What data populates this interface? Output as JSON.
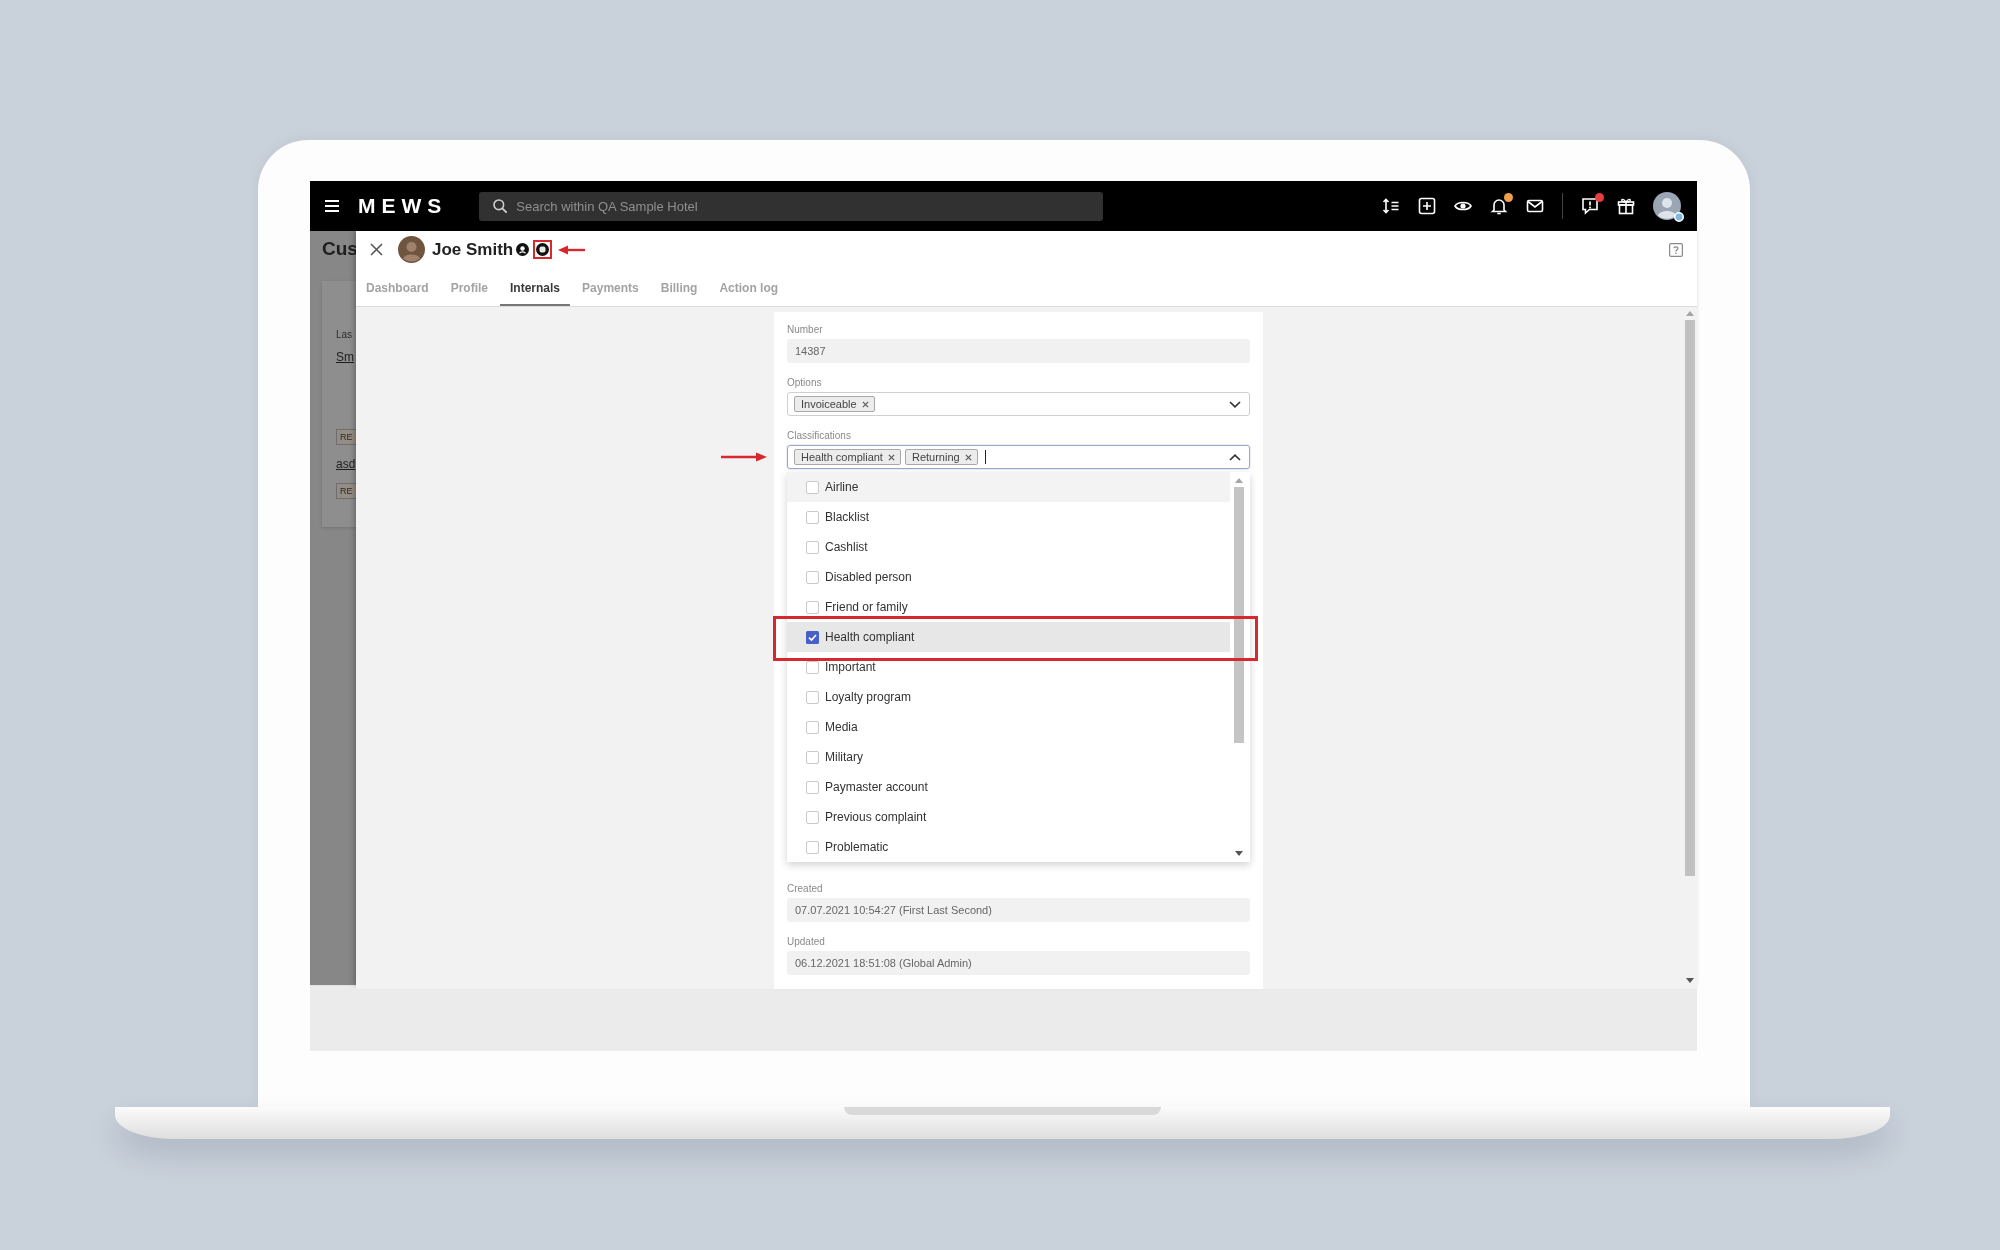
{
  "top_bar": {
    "logo": "MEWS",
    "search": {
      "placeholder": "Search within QA Sample Hotel"
    }
  },
  "background_page": {
    "title": "Cus",
    "field_label": "Las",
    "field_value": "Sm",
    "entries": [
      {
        "kind": "tag",
        "text": "RE"
      },
      {
        "kind": "link",
        "text": "asd"
      },
      {
        "kind": "tag",
        "text": "RE"
      }
    ]
  },
  "customer_panel": {
    "name": "Joe Smith",
    "tabs": [
      {
        "label": "Dashboard",
        "selected": false
      },
      {
        "label": "Profile",
        "selected": false
      },
      {
        "label": "Internals",
        "selected": true
      },
      {
        "label": "Payments",
        "selected": false
      },
      {
        "label": "Billing",
        "selected": false
      },
      {
        "label": "Action log",
        "selected": false
      }
    ]
  },
  "form": {
    "fields": [
      {
        "kind": "readonly",
        "label": "Number",
        "value": "14387"
      },
      {
        "kind": "multiselect",
        "label": "Options",
        "chips": [
          "Invoiceable"
        ],
        "expanded": false
      },
      {
        "kind": "multiselect",
        "label": "Classifications",
        "chips": [
          "Health compliant",
          "Returning"
        ],
        "expanded": true,
        "options": [
          {
            "label": "Airline",
            "checked": false,
            "focused": true,
            "hovered": false
          },
          {
            "label": "Blacklist",
            "checked": false,
            "focused": false,
            "hovered": false
          },
          {
            "label": "Cashlist",
            "checked": false,
            "focused": false,
            "hovered": false
          },
          {
            "label": "Disabled person",
            "checked": false,
            "focused": false,
            "hovered": false
          },
          {
            "label": "Friend or family",
            "checked": false,
            "focused": false,
            "hovered": false
          },
          {
            "label": "Health compliant",
            "checked": true,
            "focused": false,
            "hovered": true
          },
          {
            "label": "Important",
            "checked": false,
            "focused": false,
            "hovered": false
          },
          {
            "label": "Loyalty program",
            "checked": false,
            "focused": false,
            "hovered": false
          },
          {
            "label": "Media",
            "checked": false,
            "focused": false,
            "hovered": false
          },
          {
            "label": "Military",
            "checked": false,
            "focused": false,
            "hovered": false
          },
          {
            "label": "Paymaster account",
            "checked": false,
            "focused": false,
            "hovered": false
          },
          {
            "label": "Previous complaint",
            "checked": false,
            "focused": false,
            "hovered": false
          },
          {
            "label": "Problematic",
            "checked": false,
            "focused": false,
            "hovered": false
          }
        ]
      }
    ],
    "fields_below": [
      {
        "kind": "readonly",
        "label": "Created",
        "value": "07.07.2021 10:54:27 (First Last Second)"
      },
      {
        "kind": "readonly",
        "label": "Updated",
        "value": "06.12.2021 18:51:08 (Global Admin)"
      }
    ]
  }
}
